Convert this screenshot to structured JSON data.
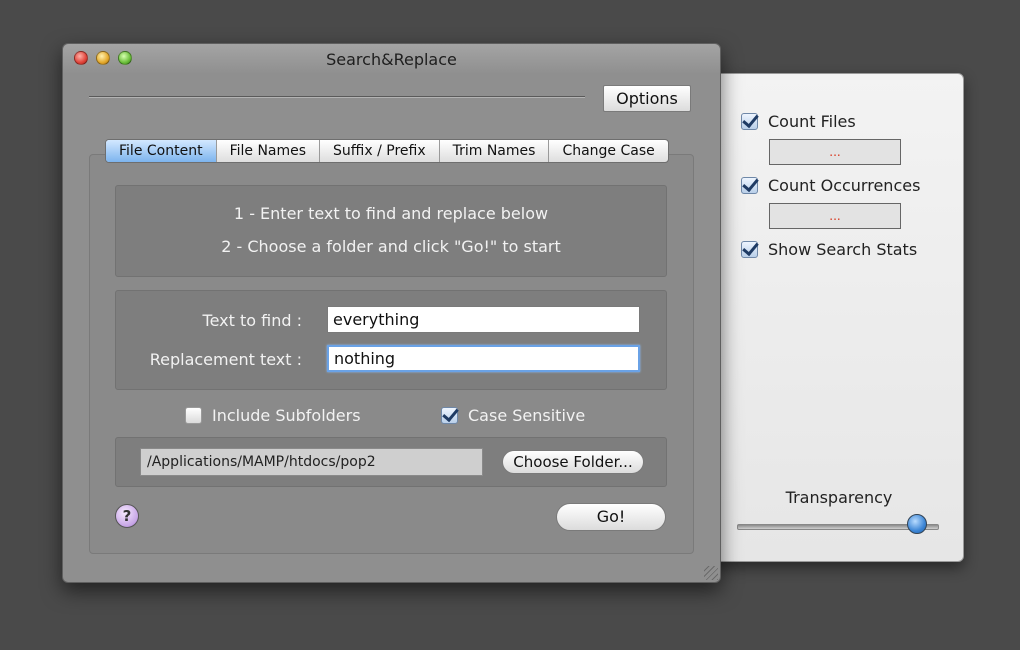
{
  "window": {
    "title": "Search&Replace"
  },
  "toolbar": {
    "options_label": "Options"
  },
  "tabs": [
    {
      "label": "File Content",
      "active": true
    },
    {
      "label": "File Names",
      "active": false
    },
    {
      "label": "Suffix / Prefix",
      "active": false
    },
    {
      "label": "Trim Names",
      "active": false
    },
    {
      "label": "Change Case",
      "active": false
    }
  ],
  "instructions": {
    "line1": "1 - Enter text to find and replace below",
    "line2": "2 - Choose a folder and click \"Go!\" to start"
  },
  "form": {
    "find_label": "Text to find :",
    "find_value": "everything",
    "replace_label": "Replacement text :",
    "replace_value": "nothing"
  },
  "options": {
    "include_subfolders": {
      "label": "Include Subfolders",
      "checked": false
    },
    "case_sensitive": {
      "label": "Case Sensitive",
      "checked": true
    }
  },
  "folder": {
    "path": "/Applications/MAMP/htdocs/pop2",
    "choose_label": "Choose Folder..."
  },
  "actions": {
    "go_label": "Go!",
    "help_symbol": "?"
  },
  "drawer": {
    "count_files": {
      "label": "Count Files",
      "checked": true,
      "value": "..."
    },
    "count_occurrences": {
      "label": "Count Occurrences",
      "checked": true,
      "value": "..."
    },
    "show_stats": {
      "label": "Show Search Stats",
      "checked": true
    },
    "transparency": {
      "label": "Transparency",
      "value": 0.9
    }
  },
  "icons": {
    "close": "close-icon",
    "minimize": "minimize-icon",
    "zoom": "zoom-icon",
    "help": "help-icon",
    "checkbox": "checkmark-icon",
    "resize": "resize-grip-icon"
  },
  "colors": {
    "window_bg": "#8f8f8f",
    "active_tab": "#7db4ee",
    "drawer_bg": "#ececec",
    "counter_text": "#d9331a"
  }
}
